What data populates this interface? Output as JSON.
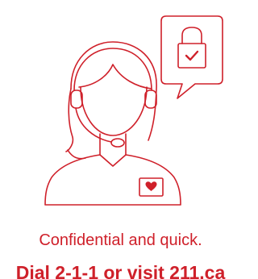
{
  "colors": {
    "accent": "#cf202a"
  },
  "illustration": {
    "icons": [
      "agent-headset-icon",
      "speech-bubble-icon",
      "padlock-icon",
      "checkmark-icon",
      "heart-badge-icon"
    ]
  },
  "tagline": "Confidential and quick.",
  "cta": "Dial 2-1-1 or visit 211.ca"
}
